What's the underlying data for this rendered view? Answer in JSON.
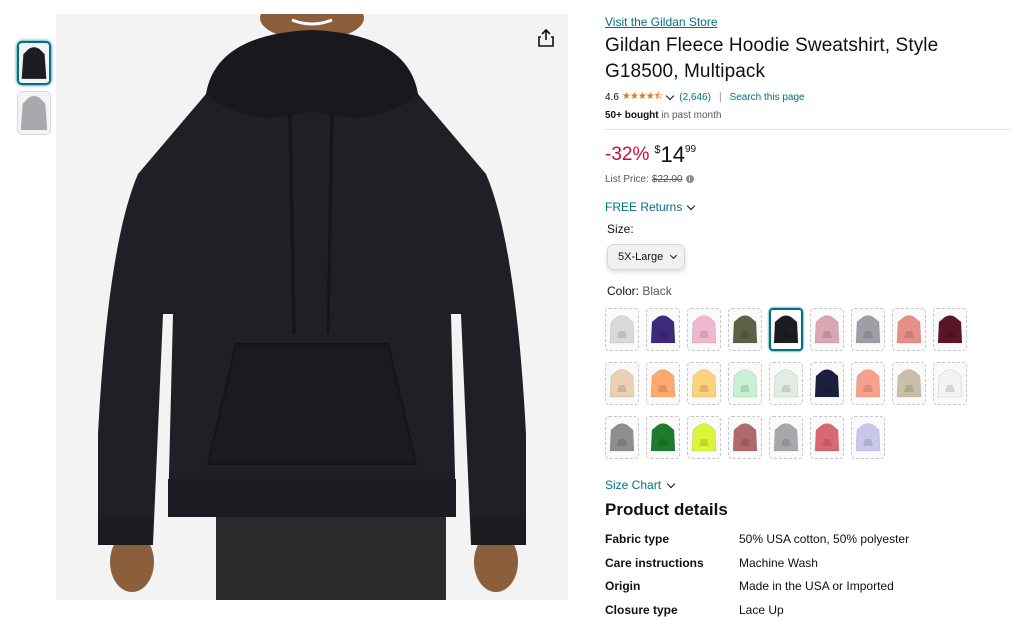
{
  "thumbnails": [
    {
      "alt": "black hoodie",
      "color": "#1c1d22",
      "selected": true
    },
    {
      "alt": "gray hoodie",
      "color": "#a7a9ac",
      "selected": false
    }
  ],
  "main_image": {
    "color": "#1f2025",
    "background": "#f3f3f3"
  },
  "share_icon": "share-icon",
  "store_link": "Visit the Gildan Store",
  "title": "Gildan Fleece Hoodie Sweatshirt, Style G18500, Multipack",
  "rating": {
    "value": "4.6",
    "stars": "★★★★⯪",
    "count": "(2,646)",
    "separator": "|",
    "search_link": "Search this page"
  },
  "bought": {
    "bold": "50+ bought",
    "rest": " in past month"
  },
  "price": {
    "discount": "-32%",
    "currency": "$",
    "whole": "14",
    "fraction": "99",
    "list_label": "List Price:",
    "list_value": "$22.00",
    "info_icon": "i"
  },
  "returns": "FREE Returns",
  "size": {
    "label": "Size:",
    "selected": "5X-Large"
  },
  "color": {
    "label": "Color: ",
    "selected": "Black"
  },
  "swatches": [
    {
      "color": "#d9d9d9",
      "selected": false
    },
    {
      "color": "#3e2a7a",
      "selected": false
    },
    {
      "color": "#efb8cf",
      "selected": false
    },
    {
      "color": "#5e6147",
      "selected": false
    },
    {
      "color": "#1c1d22",
      "selected": true
    },
    {
      "color": "#d8a7b3",
      "selected": false
    },
    {
      "color": "#9c9fa3",
      "selected": false
    },
    {
      "color": "#e49088",
      "selected": false
    },
    {
      "color": "#5a1526",
      "selected": false
    },
    {
      "color": "#ead0b4",
      "selected": false
    },
    {
      "color": "#fda86e",
      "selected": false
    },
    {
      "color": "#fcd27a",
      "selected": false
    },
    {
      "color": "#c8f0d2",
      "selected": false
    },
    {
      "color": "#e3ece2",
      "selected": false
    },
    {
      "color": "#1b1f3d",
      "selected": false
    },
    {
      "color": "#f7a18c",
      "selected": false
    },
    {
      "color": "#c8bfa7",
      "selected": false
    },
    {
      "color": "#f3f3f3",
      "selected": false
    },
    {
      "color": "#8e8e8e",
      "selected": false
    },
    {
      "color": "#1e7b2e",
      "selected": false
    },
    {
      "color": "#dcf538",
      "selected": false
    },
    {
      "color": "#b06a6b",
      "selected": false
    },
    {
      "color": "#a6a8ab",
      "selected": false
    },
    {
      "color": "#d96872",
      "selected": false
    },
    {
      "color": "#c9c7ea",
      "selected": false
    }
  ],
  "size_chart": "Size Chart",
  "details": {
    "heading": "Product details",
    "rows": [
      {
        "key": "Fabric type",
        "value": "50% USA cotton, 50% polyester"
      },
      {
        "key": "Care instructions",
        "value": "Machine Wash"
      },
      {
        "key": "Origin",
        "value": "Made in the USA or Imported"
      },
      {
        "key": "Closure type",
        "value": "Lace Up"
      }
    ]
  }
}
